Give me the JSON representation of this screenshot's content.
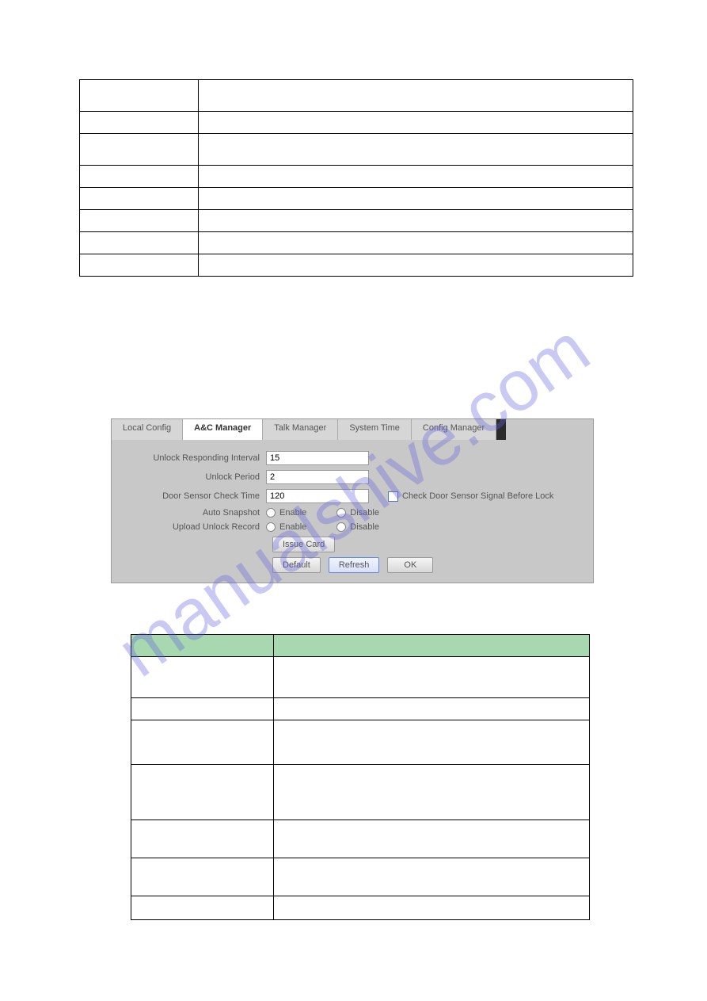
{
  "watermark": "manualshive.com",
  "tabs": {
    "local_config": "Local Config",
    "ac_manager": "A&C Manager",
    "talk_manager": "Talk Manager",
    "system_time": "System Time",
    "config_manager": "Config Manager"
  },
  "form": {
    "unlock_responding_interval_label": "Unlock Responding Interval",
    "unlock_responding_interval_value": "15",
    "unlock_period_label": "Unlock Period",
    "unlock_period_value": "2",
    "door_sensor_check_label": "Door Sensor Check Time",
    "door_sensor_check_value": "120",
    "check_door_sensor_label": "Check Door Sensor Signal Before Lock",
    "auto_snapshot_label": "Auto Snapshot",
    "upload_unlock_label": "Upload Unlock Record",
    "enable_label": "Enable",
    "disable_label": "Disable"
  },
  "buttons": {
    "issue_card": "Issue Card",
    "default": "Default",
    "refresh": "Refresh",
    "ok": "OK"
  }
}
